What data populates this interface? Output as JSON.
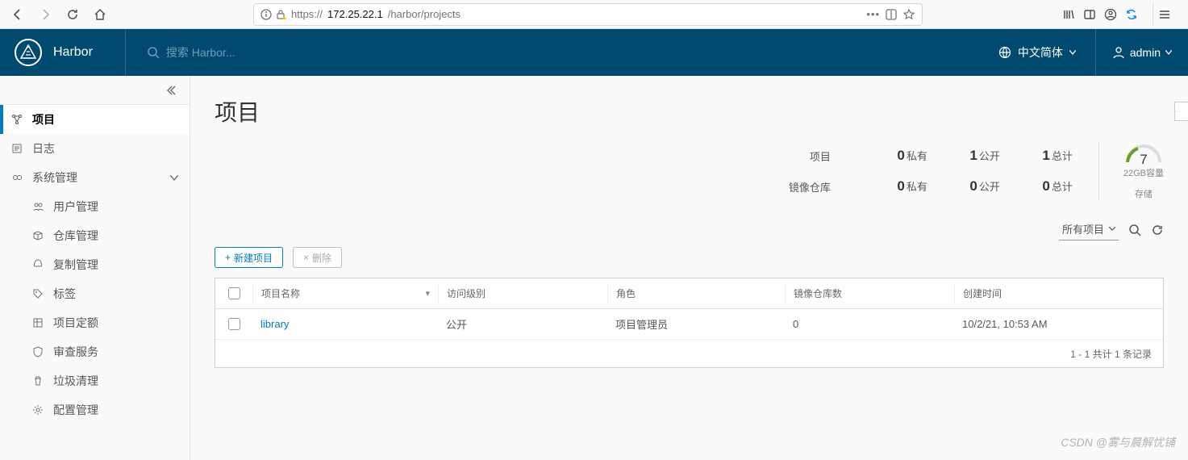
{
  "browser": {
    "url_prefix": "https://",
    "url_bold": "172.25.22.1",
    "url_path": "/harbor/projects"
  },
  "header": {
    "app_name": "Harbor",
    "search_placeholder": "搜索 Harbor...",
    "language": "中文简体",
    "user": "admin"
  },
  "sidebar": {
    "items": [
      {
        "icon": "projects",
        "label": "项目"
      },
      {
        "icon": "logs",
        "label": "日志"
      },
      {
        "icon": "admin",
        "label": "系统管理"
      }
    ],
    "sub_items": [
      {
        "icon": "users",
        "label": "用户管理"
      },
      {
        "icon": "repo",
        "label": "仓库管理"
      },
      {
        "icon": "repl",
        "label": "复制管理"
      },
      {
        "icon": "tag",
        "label": "标签"
      },
      {
        "icon": "quota",
        "label": "项目定额"
      },
      {
        "icon": "audit",
        "label": "审查服务"
      },
      {
        "icon": "gc",
        "label": "垃圾清理"
      },
      {
        "icon": "config",
        "label": "配置管理"
      }
    ]
  },
  "main": {
    "title": "项目",
    "stats": {
      "row1_label": "项目",
      "row2_label": "镜像仓库",
      "private_suffix": "私有",
      "public_suffix": "公开",
      "total_suffix": "总计",
      "project_private": "0",
      "project_public": "1",
      "project_total": "1",
      "repo_private": "0",
      "repo_public": "0",
      "repo_total": "0",
      "storage_value": "7",
      "storage_capacity": "22GB容量",
      "storage_label": "存储"
    },
    "filter": {
      "label": "所有项目"
    },
    "actions": {
      "new": "新建项目",
      "delete": "删除"
    },
    "table": {
      "cols": [
        "项目名称",
        "访问级别",
        "角色",
        "镜像仓库数",
        "创建时间"
      ],
      "rows": [
        {
          "name": "library",
          "access": "公开",
          "role": "项目管理员",
          "repos": "0",
          "created": "10/2/21, 10:53 AM"
        }
      ],
      "footer": "1 - 1 共计 1 条记录"
    }
  },
  "watermark": "CSDN @雾与晨解忧铺"
}
